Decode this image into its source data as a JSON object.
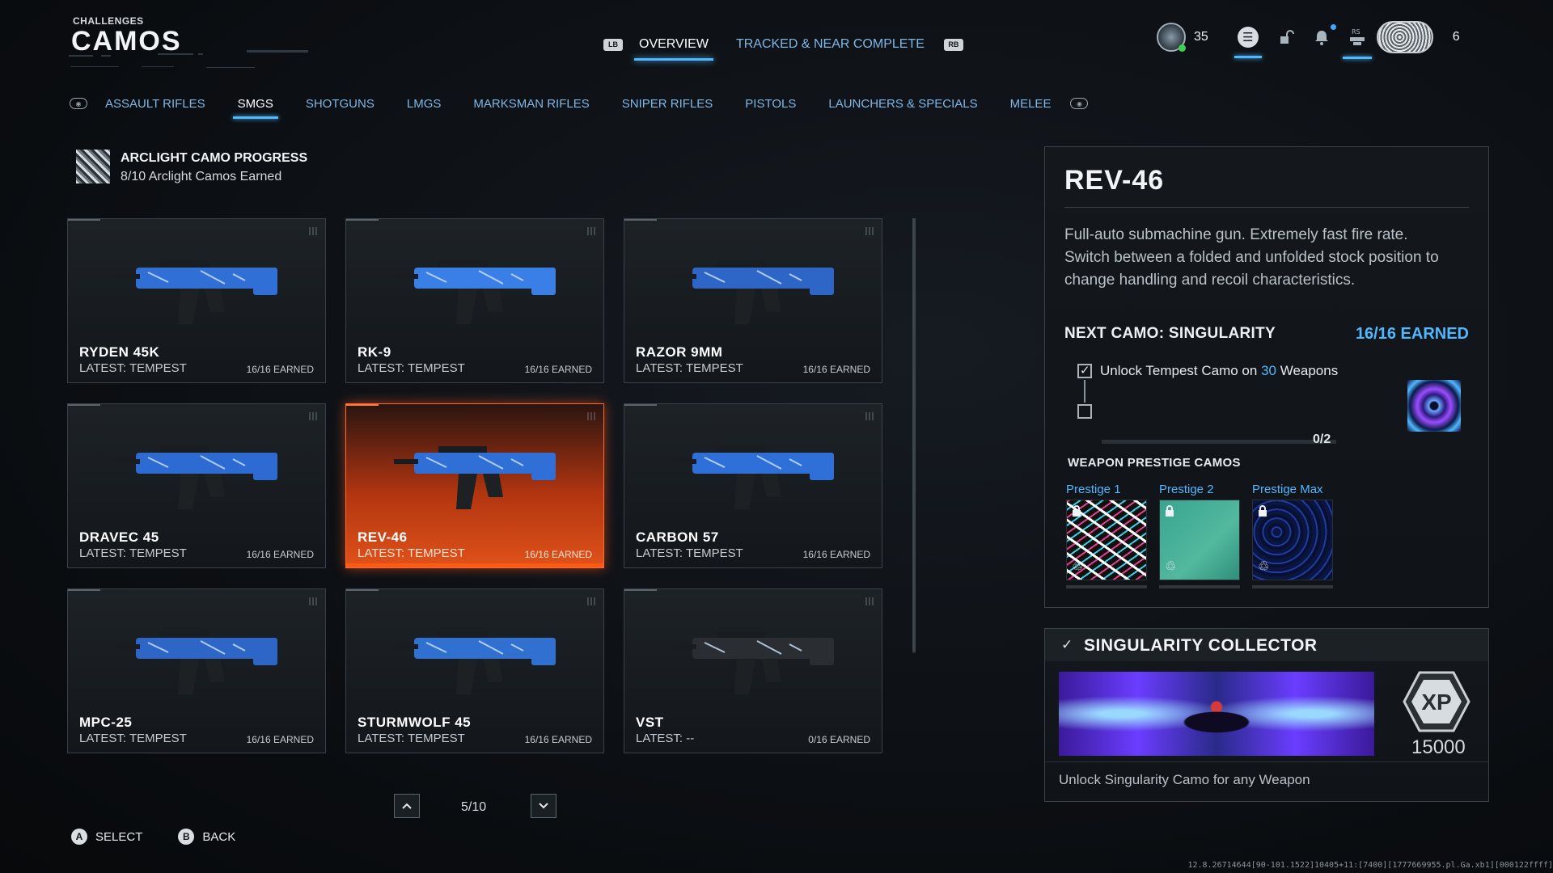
{
  "header": {
    "subtitle": "CHALLENGES",
    "title": "CAMOS",
    "left_key": "LB",
    "right_key": "RB",
    "tabs": [
      {
        "label": "OVERVIEW",
        "active": true
      },
      {
        "label": "TRACKED & NEAR COMPLETE",
        "active": false
      }
    ]
  },
  "status": {
    "level": "35",
    "rs_key": "RS",
    "party_count": "6",
    "icons": [
      "rank-icon",
      "menu-icon",
      "social-icon",
      "bell-icon",
      "profile-icon",
      "emblem"
    ]
  },
  "categories": {
    "items": [
      {
        "label": "ASSAULT RIFLES",
        "active": false
      },
      {
        "label": "SMGS",
        "active": true
      },
      {
        "label": "SHOTGUNS",
        "active": false
      },
      {
        "label": "LMGS",
        "active": false
      },
      {
        "label": "MARKSMAN RIFLES",
        "active": false
      },
      {
        "label": "SNIPER RIFLES",
        "active": false
      },
      {
        "label": "PISTOLS",
        "active": false
      },
      {
        "label": "LAUNCHERS & SPECIALS",
        "active": false
      },
      {
        "label": "MELEE",
        "active": false
      }
    ]
  },
  "progress": {
    "title": "ARCLIGHT CAMO PROGRESS",
    "subtitle": "8/10 Arclight Camos Earned"
  },
  "weapons": [
    {
      "name": "RYDEN 45K",
      "latest": "LATEST: TEMPEST",
      "earned": "16/16 EARNED",
      "selected": false
    },
    {
      "name": "RK-9",
      "latest": "LATEST: TEMPEST",
      "earned": "16/16 EARNED",
      "selected": false
    },
    {
      "name": "RAZOR 9MM",
      "latest": "LATEST: TEMPEST",
      "earned": "16/16 EARNED",
      "selected": false
    },
    {
      "name": "DRAVEC 45",
      "latest": "LATEST: TEMPEST",
      "earned": "16/16 EARNED",
      "selected": false
    },
    {
      "name": "REV-46",
      "latest": "LATEST: TEMPEST",
      "earned": "16/16 EARNED",
      "selected": true
    },
    {
      "name": "CARBON 57",
      "latest": "LATEST: TEMPEST",
      "earned": "16/16 EARNED",
      "selected": false
    },
    {
      "name": "MPC-25",
      "latest": "LATEST: TEMPEST",
      "earned": "16/16 EARNED",
      "selected": false
    },
    {
      "name": "STURMWOLF 45",
      "latest": "LATEST: TEMPEST",
      "earned": "16/16 EARNED",
      "selected": false
    },
    {
      "name": "VST",
      "latest": "LATEST: --",
      "earned": "0/16 EARNED",
      "selected": false
    }
  ],
  "pagination": {
    "text": "5/10"
  },
  "footer": {
    "select_key": "A",
    "select_label": "SELECT",
    "back_key": "B",
    "back_label": "BACK"
  },
  "build_string": "12.8.26714644[90-101.1522]10405+11:[7400][1777669955.pl.Ga.xb1][000122ffff]",
  "detail": {
    "title": "REV-46",
    "description": "Full-auto submachine gun. Extremely fast fire rate. Switch between a folded and unfolded stock position to change handling and recoil characteristics.",
    "next_camo_label": "NEXT CAMO: SINGULARITY",
    "next_camo_earned": "16/16 EARNED",
    "challenge_pre": "Unlock Tempest Camo on ",
    "challenge_count": "30",
    "challenge_post": " Weapons",
    "challenge_progress_text": "0/2",
    "challenge_progress": 0,
    "prestige_heading": "WEAPON PRESTIGE CAMOS",
    "prestige": [
      {
        "label": "Prestige 1"
      },
      {
        "label": "Prestige 2"
      },
      {
        "label": "Prestige Max"
      }
    ]
  },
  "collector": {
    "title": "SINGULARITY COLLECTOR",
    "xp_label": "XP",
    "xp_value": "15000",
    "description": "Unlock Singularity Camo for any Weapon"
  },
  "colors": {
    "accent": "#4fb8ff",
    "selected": "#e0521a",
    "panel_border": "#3a4148"
  }
}
